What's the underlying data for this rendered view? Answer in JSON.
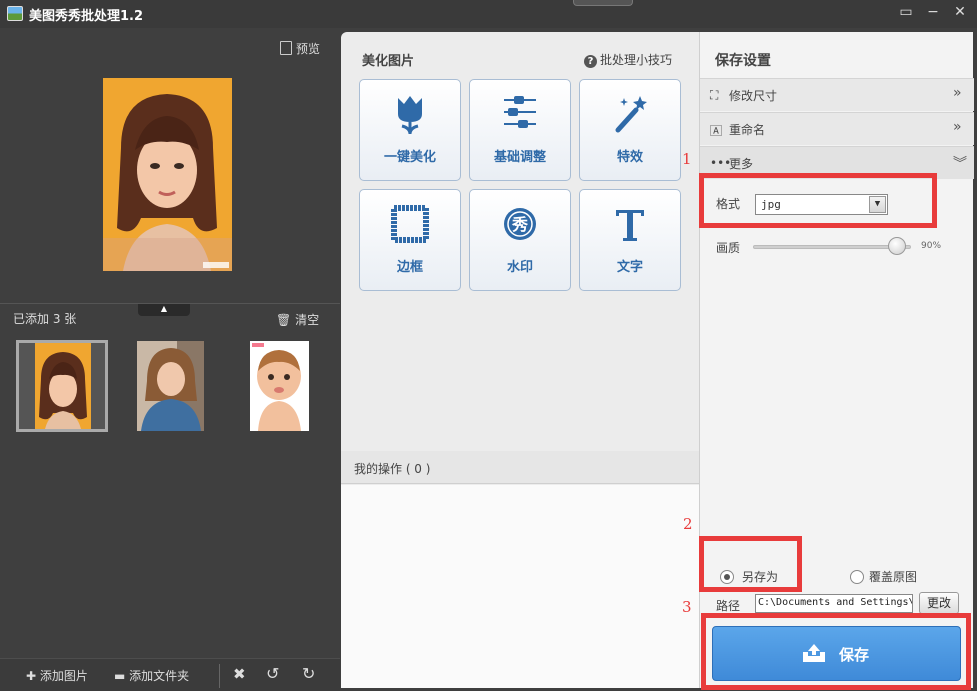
{
  "window": {
    "title": "美图秀秀批处理1.2"
  },
  "window_controls": {
    "feedback": "▭",
    "minimize": "−",
    "close": "✕"
  },
  "left": {
    "preview_label": "预览",
    "added_count": "已添加 3 张",
    "clear_label": "清空",
    "toolbar": {
      "add_image": "添加图片",
      "add_folder": "添加文件夹"
    }
  },
  "middle": {
    "title": "美化图片",
    "tips": "批处理小技巧",
    "tools": [
      {
        "label": "一键美化",
        "icon": "tulip-icon"
      },
      {
        "label": "基础调整",
        "icon": "sliders-icon"
      },
      {
        "label": "特效",
        "icon": "magic-wand-icon"
      },
      {
        "label": "边框",
        "icon": "frame-icon"
      },
      {
        "label": "水印",
        "icon": "watermark-icon"
      },
      {
        "label": "文字",
        "icon": "text-icon"
      }
    ],
    "ops_title": "我的操作 ( 0 )"
  },
  "right": {
    "title": "保存设置",
    "sections": [
      {
        "label": "修改尺寸",
        "icon": "crop-icon",
        "arrow": "»"
      },
      {
        "label": "重命名",
        "icon": "rename-icon",
        "arrow": "»"
      },
      {
        "label": "更多",
        "icon": "more-icon",
        "arrow": "︾"
      }
    ],
    "format_label": "格式",
    "format_value": "jpg",
    "quality_label": "画质",
    "quality_value": "90%",
    "quality_fraction": 0.9,
    "save_as_label": "另存为",
    "overwrite_label": "覆盖原图",
    "path_label": "路径",
    "path_value": "C:\\Documents and Settings\\",
    "change_label": "更改",
    "save_label": "保存"
  },
  "annotations": [
    "1",
    "2",
    "3"
  ],
  "colors": {
    "accent": "#3f8ad8",
    "annotation": "#e83b3b"
  }
}
